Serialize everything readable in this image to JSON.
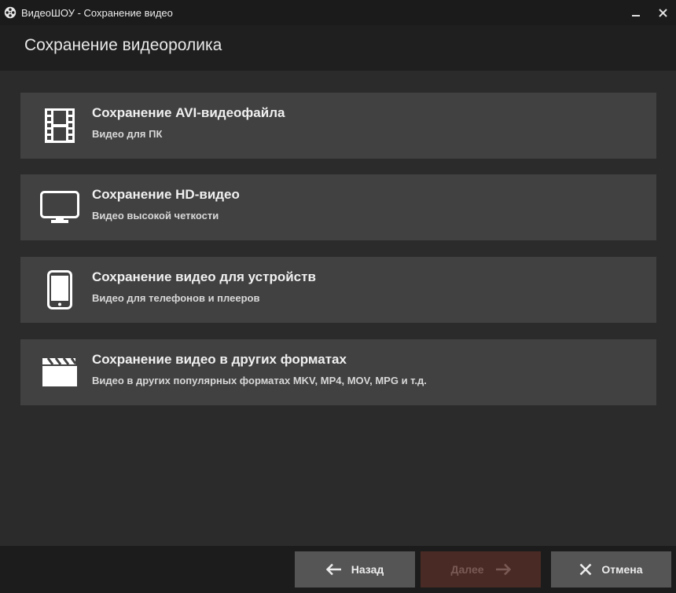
{
  "window": {
    "title": "ВидеоШОУ - Сохранение видео"
  },
  "header": {
    "title": "Сохранение видеоролика"
  },
  "options": [
    {
      "icon": "film-strip-icon",
      "title": "Сохранение AVI-видеофайла",
      "subtitle": "Видео для ПК"
    },
    {
      "icon": "monitor-icon",
      "title": "Сохранение HD-видео",
      "subtitle": "Видео высокой четкости"
    },
    {
      "icon": "smartphone-icon",
      "title": "Сохранение видео для устройств",
      "subtitle": "Видео для телефонов и плееров"
    },
    {
      "icon": "clapperboard-icon",
      "title": "Сохранение видео в других форматах",
      "subtitle": "Видео в других популярных форматах MKV, MP4, MOV, MPG и т.д."
    }
  ],
  "footer": {
    "back_label": "Назад",
    "next_label": "Далее",
    "cancel_label": "Отмена"
  },
  "colors": {
    "next_button_bg": "#4a2a24",
    "option_bg": "#414141",
    "header_bg": "#1f1f1f"
  }
}
